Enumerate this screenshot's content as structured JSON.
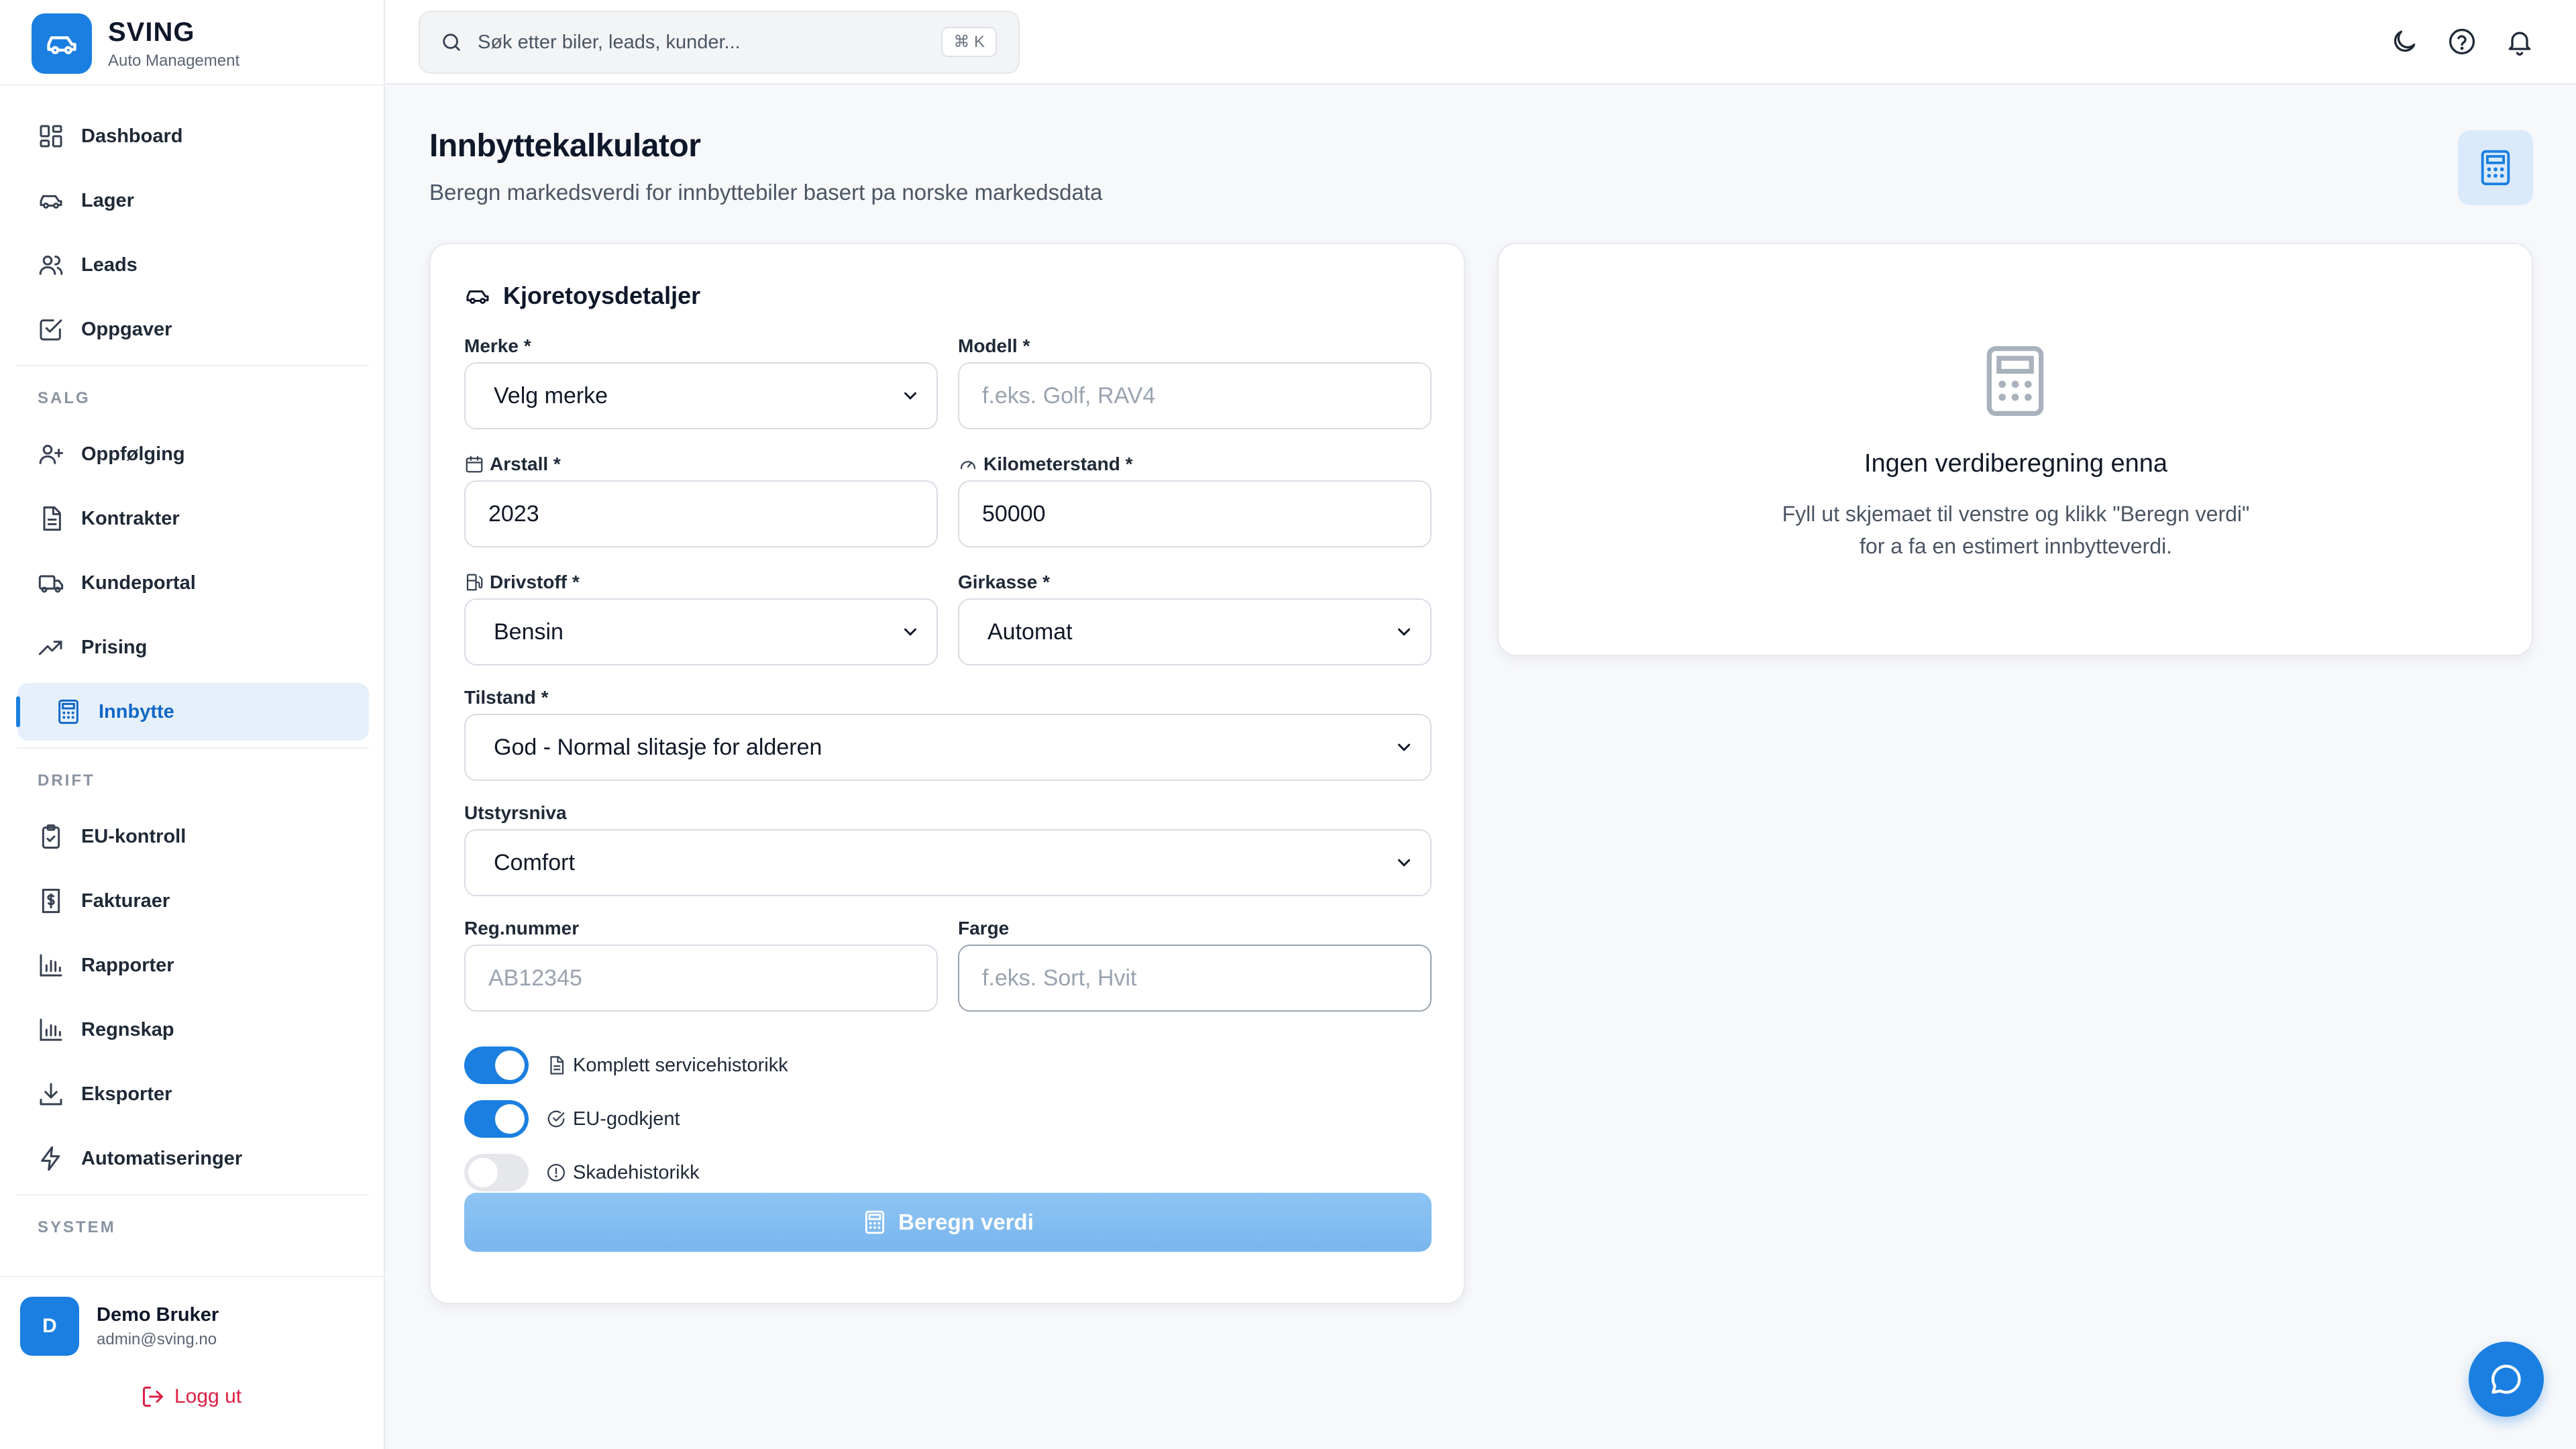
{
  "brand": {
    "title": "SVING",
    "subtitle": "Auto Management"
  },
  "sidebar": {
    "main_items": [
      {
        "label": "Dashboard",
        "icon": "dashboard-icon"
      },
      {
        "label": "Lager",
        "icon": "car-icon"
      },
      {
        "label": "Leads",
        "icon": "users-icon"
      },
      {
        "label": "Oppgaver",
        "icon": "checkbox-icon"
      }
    ],
    "sections": [
      {
        "label": "SALG",
        "items": [
          {
            "label": "Oppfølging",
            "icon": "user-plus-icon"
          },
          {
            "label": "Kontrakter",
            "icon": "document-icon"
          },
          {
            "label": "Kundeportal",
            "icon": "car-portal-icon"
          },
          {
            "label": "Prising",
            "icon": "trending-up-icon"
          },
          {
            "label": "Innbytte",
            "icon": "calculator-icon",
            "active": true
          }
        ]
      },
      {
        "label": "DRIFT",
        "items": [
          {
            "label": "EU-kontroll",
            "icon": "clipboard-check-icon"
          },
          {
            "label": "Fakturaer",
            "icon": "invoice-icon"
          },
          {
            "label": "Rapporter",
            "icon": "bar-chart-icon"
          },
          {
            "label": "Regnskap",
            "icon": "bar-chart-icon"
          },
          {
            "label": "Eksporter",
            "icon": "download-icon"
          },
          {
            "label": "Automatiseringer",
            "icon": "lightning-icon"
          }
        ]
      },
      {
        "label": "SYSTEM",
        "items": []
      }
    ]
  },
  "user": {
    "initial": "D",
    "name": "Demo Bruker",
    "email": "admin@sving.no",
    "logout_label": "Logg ut"
  },
  "topbar": {
    "search_placeholder": "Søk etter biler, leads, kunder...",
    "shortcut": "⌘ K"
  },
  "page": {
    "title": "Innbyttekalkulator",
    "subtitle": "Beregn markedsverdi for innbyttebiler basert pa norske markedsdata"
  },
  "form": {
    "title": "Kjoretoysdetaljer",
    "merke": {
      "label": "Merke *",
      "value": "Velg merke"
    },
    "modell": {
      "label": "Modell *",
      "placeholder": "f.eks. Golf, RAV4"
    },
    "arsmodell": {
      "label": "Arstall *",
      "value": "2023"
    },
    "km": {
      "label": "Kilometerstand *",
      "value": "50000"
    },
    "drivstoff": {
      "label": "Drivstoff *",
      "value": "Bensin"
    },
    "girkasse": {
      "label": "Girkasse *",
      "value": "Automat"
    },
    "tilstand": {
      "label": "Tilstand *",
      "value": "God - Normal slitasje for alderen"
    },
    "utstyr": {
      "label": "Utstyrsniva",
      "value": "Comfort"
    },
    "regnr": {
      "label": "Reg.nummer",
      "placeholder": "AB12345"
    },
    "farge": {
      "label": "Farge",
      "placeholder": "f.eks. Sort, Hvit"
    },
    "toggles": [
      {
        "label": "Komplett servicehistorikk",
        "on": true
      },
      {
        "label": "EU-godkjent",
        "on": true
      },
      {
        "label": "Skadehistorikk",
        "on": false
      }
    ],
    "submit_label": "Beregn verdi"
  },
  "result": {
    "title": "Ingen verdiberegning enna",
    "text_line1": "Fyll ut skjemaet til venstre og klikk \"Beregn verdi\"",
    "text_line2": "for a fa en estimert innbytteverdi."
  },
  "colors": {
    "accent": "#1a7fe0",
    "active_bg": "#e6f0fb",
    "logout": "#dc2045",
    "button_disabled": "#8ec4f3"
  }
}
